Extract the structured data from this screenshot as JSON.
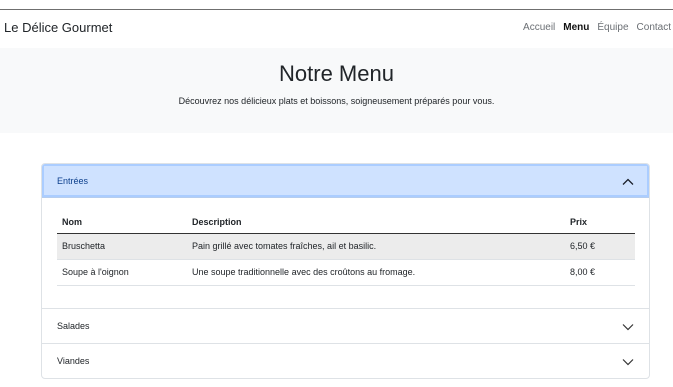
{
  "nav": {
    "brand": "Le Délice Gourmet",
    "links": [
      {
        "label": "Accueil",
        "active": false
      },
      {
        "label": "Menu",
        "active": true
      },
      {
        "label": "Équipe",
        "active": false
      },
      {
        "label": "Contact",
        "active": false
      }
    ]
  },
  "hero": {
    "title": "Notre Menu",
    "subtitle": "Découvrez nos délicieux plats et boissons, soigneusement préparés pour vous."
  },
  "accordion": {
    "sections": [
      {
        "label": "Entrées",
        "expanded": true
      },
      {
        "label": "Salades",
        "expanded": false
      },
      {
        "label": "Viandes",
        "expanded": false
      }
    ],
    "table": {
      "headers": {
        "name": "Nom",
        "description": "Description",
        "price": "Prix"
      },
      "rows": [
        {
          "name": "Bruschetta",
          "description": "Pain grillé avec tomates fraîches, ail et basilic.",
          "price": "6,50 €"
        },
        {
          "name": "Soupe à l'oignon",
          "description": "Une soupe traditionnelle avec des croûtons au fromage.",
          "price": "8,00 €"
        }
      ]
    }
  },
  "colors": {
    "open_header_bg": "#cfe2ff",
    "hero_bg": "#f8f9fa"
  },
  "icons": {
    "expanded": "chevron-up-icon",
    "collapsed": "chevron-down-icon"
  }
}
